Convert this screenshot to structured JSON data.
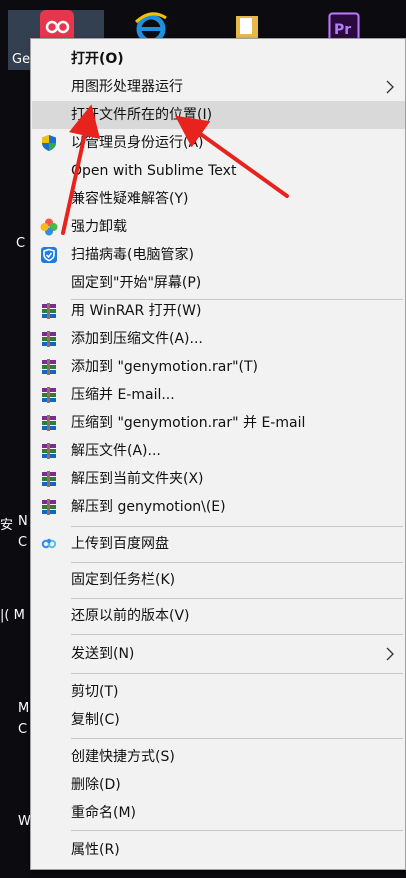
{
  "desktop": {
    "labels": {
      "genymotion_short": "Ge",
      "c1": "C",
      "c2": "C",
      "n_fragment": "N",
      "an_fragment": "安",
      "m_fragment1": "|( M",
      "m_fragment2": "M",
      "c3": "C",
      "w_fragment": "W"
    }
  },
  "menu": {
    "items": [
      {
        "label": "打开(O)",
        "bold": true
      },
      {
        "label": "用图形处理器运行",
        "submenu": true
      },
      {
        "label": "打开文件所在的位置(I)",
        "highlighted": true
      },
      {
        "label": "以管理员身份运行(A)",
        "icon": "shield-icon"
      },
      {
        "label": "Open with Sublime Text"
      },
      {
        "label": "兼容性疑难解答(Y)"
      },
      {
        "label": "强力卸载",
        "icon": "uninstall-flower-icon"
      },
      {
        "label": "扫描病毒(电脑管家)",
        "icon": "pc-manager-shield-icon"
      },
      {
        "label": "固定到\"开始\"屏幕(P)"
      },
      {
        "label": "用 WinRAR 打开(W)",
        "icon": "winrar-icon"
      },
      {
        "label": "添加到压缩文件(A)...",
        "icon": "winrar-icon"
      },
      {
        "label": "添加到 \"genymotion.rar\"(T)",
        "icon": "winrar-icon"
      },
      {
        "label": "压缩并 E-mail...",
        "icon": "winrar-icon"
      },
      {
        "label": "压缩到 \"genymotion.rar\" 并 E-mail",
        "icon": "winrar-icon"
      },
      {
        "label": "解压文件(A)...",
        "icon": "winrar-icon"
      },
      {
        "label": "解压到当前文件夹(X)",
        "icon": "winrar-icon"
      },
      {
        "label": "解压到 genymotion\\(E)",
        "icon": "winrar-icon"
      },
      {
        "label": "上传到百度网盘",
        "icon": "baidu-cloud-icon"
      },
      {
        "label": "固定到任务栏(K)"
      },
      {
        "label": "还原以前的版本(V)"
      },
      {
        "label": "发送到(N)",
        "submenu": true
      },
      {
        "label": "剪切(T)"
      },
      {
        "label": "复制(C)"
      },
      {
        "label": "创建快捷方式(S)"
      },
      {
        "label": "删除(D)"
      },
      {
        "label": "重命名(M)"
      },
      {
        "label": "属性(R)"
      }
    ]
  },
  "colors": {
    "highlight": "#d9d9d9",
    "annotation_arrow": "#e8231d",
    "menu_bg": "#f2f2f2"
  }
}
